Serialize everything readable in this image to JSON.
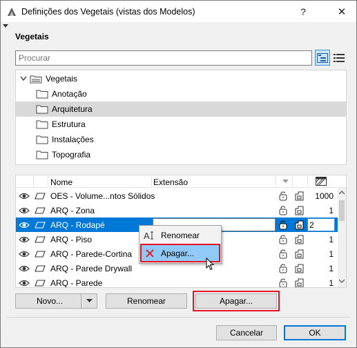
{
  "window": {
    "title": "Definições dos Vegetais (vistas dos Modelos)",
    "help_label": "?",
    "close_label": "✕"
  },
  "section": {
    "title": "Vegetais"
  },
  "search": {
    "placeholder": "Procurar",
    "value": ""
  },
  "tree": {
    "root": {
      "label": "Vegetais",
      "expanded": true
    },
    "items": [
      {
        "label": "Anotação",
        "selected": false
      },
      {
        "label": "Arquitetura",
        "selected": true
      },
      {
        "label": "Estrutura",
        "selected": false
      },
      {
        "label": "Instalações",
        "selected": false
      },
      {
        "label": "Topografia",
        "selected": false
      }
    ]
  },
  "list": {
    "columns": {
      "name": "Nome",
      "extension": "Extensão"
    },
    "rows": [
      {
        "name": "OES - Volume...ntos Sólidos",
        "value": "1000",
        "selected": false
      },
      {
        "name": "ARQ - Zona",
        "value": "1",
        "selected": false
      },
      {
        "name": "ARQ - Rodapé",
        "value": "2",
        "selected": true
      },
      {
        "name": "ARQ - Piso",
        "value": "1",
        "selected": false
      },
      {
        "name": "ARQ - Parede-Cortina",
        "value": "1",
        "selected": false
      },
      {
        "name": "ARQ - Parede Drywall",
        "value": "1",
        "selected": false
      },
      {
        "name": "ARQ - Parede",
        "value": "1",
        "selected": false
      }
    ]
  },
  "context_menu": {
    "items": [
      {
        "label": "Renomear",
        "icon": "rename-icon"
      },
      {
        "label": "Apagar...",
        "icon": "delete-x-icon"
      }
    ]
  },
  "buttons": {
    "new": "Novo...",
    "rename": "Renomear",
    "delete": "Apagar...",
    "cancel": "Cancelar",
    "ok": "OK"
  },
  "colors": {
    "selection": "#0078d7",
    "menu_hover": "#91c9f7",
    "highlight": "#e81123"
  }
}
